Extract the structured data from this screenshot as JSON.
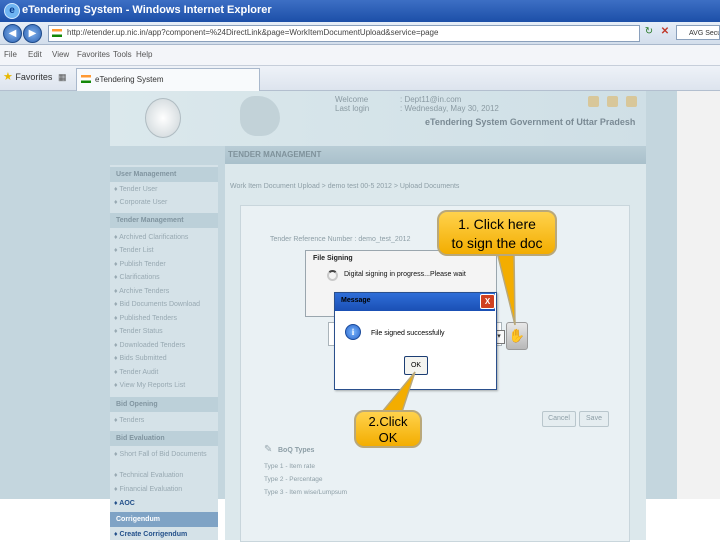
{
  "browser": {
    "title": "eTendering System - Windows Internet Explorer",
    "url": "http://etender.up.nic.in/app?component=%24DirectLink&page=WorkItemDocumentUpload&service=page",
    "search_label": "AVG Secure",
    "menu": [
      "File",
      "Edit",
      "View",
      "Favorites",
      "Tools",
      "Help"
    ],
    "favorites_label": "Favorites",
    "tab_label": "eTendering System"
  },
  "site": {
    "welcome_label": "Welcome",
    "welcome_value": ": Dept11@in.com",
    "lastlogin_label": "Last login",
    "lastlogin_value": ": Wednesday, May 30, 2012",
    "title": "eTendering System Government of Uttar Pradesh",
    "section_title": "TENDER MANAGEMENT",
    "breadcrumb": "Work Item Document Upload > demo test 00-5 2012 > Upload Documents",
    "reference_line": "Tender Reference Number : demo_test_2012"
  },
  "sidebar": {
    "user_management": {
      "header": "User Management",
      "items": [
        "Tender User",
        "Corporate User"
      ]
    },
    "tender_management": {
      "header": "Tender Management",
      "items": [
        "Archived Clarifications",
        "Tender List",
        "Publish Tender",
        "Clarifications",
        "Archive Tenders",
        "Bid Documents Download",
        "Published Tenders",
        "Tender Status",
        "Downloaded Tenders",
        "Bids Submitted",
        "Tender Audit",
        "View My Reports List"
      ]
    },
    "bid_opening": {
      "header": "Bid Opening",
      "items": [
        "Tenders"
      ]
    },
    "bid_evaluation": {
      "header": "Bid Evaluation",
      "items": [
        "Short Fall of Bid Documents",
        "Technical Evaluation",
        "Financial Evaluation",
        "AOC"
      ]
    },
    "corrigendum": {
      "header": "Corrigendum",
      "items": [
        "Create Corrigendum"
      ]
    }
  },
  "buttons": {
    "cancel": "Cancel",
    "save": "Save"
  },
  "boq": {
    "title": "BoQ Types",
    "lines": [
      "Type 1 - Item rate",
      "Type 2 - Percentage",
      "Type 3 - Item wise/Lumpsum"
    ]
  },
  "file_signing": {
    "title": "File Signing",
    "status": "Digital signing in progress...Please wait"
  },
  "message_box": {
    "title": "Message",
    "close": "X",
    "text": "File signed successfully",
    "ok": "OK",
    "info_icon": "i"
  },
  "callouts": {
    "sign_line1": "1. Click here",
    "sign_line2": "to sign the doc",
    "ok_line1": "2.Click",
    "ok_line2": "OK"
  },
  "icons": {
    "ie": "e",
    "back": "◀",
    "forward": "▶",
    "refresh": "↻",
    "stop": "✕",
    "select": "▾",
    "hand": "✋"
  },
  "colors": {
    "titlebar": "#1c4fa8",
    "callout": "#f3ad00",
    "page_bg": "#c4d6de",
    "active_link": "#23508a"
  }
}
